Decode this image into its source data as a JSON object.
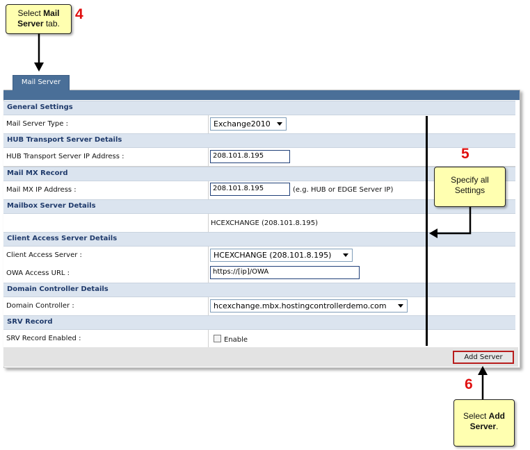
{
  "callouts": {
    "step4": {
      "num": "4",
      "pre": "Select ",
      "bold": "Mail Server",
      "post": " tab."
    },
    "step5": {
      "num": "5",
      "text": "Specify all Settings"
    },
    "step6": {
      "num": "6",
      "pre": "Select ",
      "bold": "Add Server",
      "post": "."
    }
  },
  "tab": {
    "label": "Mail Server"
  },
  "sections": {
    "general": "General Settings",
    "hub": "HUB Transport Server Details",
    "mx": "Mail MX Record",
    "mailbox": "Mailbox Server Details",
    "cas": "Client Access Server Details",
    "dc": "Domain Controller Details",
    "srv": "SRV Record"
  },
  "fields": {
    "mail_server_type": {
      "label": "Mail Server Type :",
      "value": "Exchange2010"
    },
    "hub_ip": {
      "label": "HUB Transport Server IP Address :",
      "value": "208.101.8.195"
    },
    "mx_ip": {
      "label": "Mail MX IP Address :",
      "value": "208.101.8.195",
      "hint": "(e.g. HUB or EDGE Server IP)"
    },
    "mailbox": {
      "value": "HCEXCHANGE (208.101.8.195)"
    },
    "cas": {
      "label": "Client Access Server :",
      "value": "HCEXCHANGE (208.101.8.195)"
    },
    "owa": {
      "label": "OWA Access URL :",
      "value": "https://[ip]/OWA"
    },
    "dc": {
      "label": "Domain Controller :",
      "value": "hcexchange.mbx.hostingcontrollerdemo.com"
    },
    "srv": {
      "label": "SRV Record Enabled :",
      "checkbox_label": "Enable",
      "checked": false
    }
  },
  "footer": {
    "add_server": "Add Server"
  },
  "colors": {
    "accent": "#4a6f98",
    "section_bg": "#dbe4ef",
    "callout_bg": "#ffffb0",
    "step_red": "#e01010",
    "highlight": "#b81c1c"
  }
}
